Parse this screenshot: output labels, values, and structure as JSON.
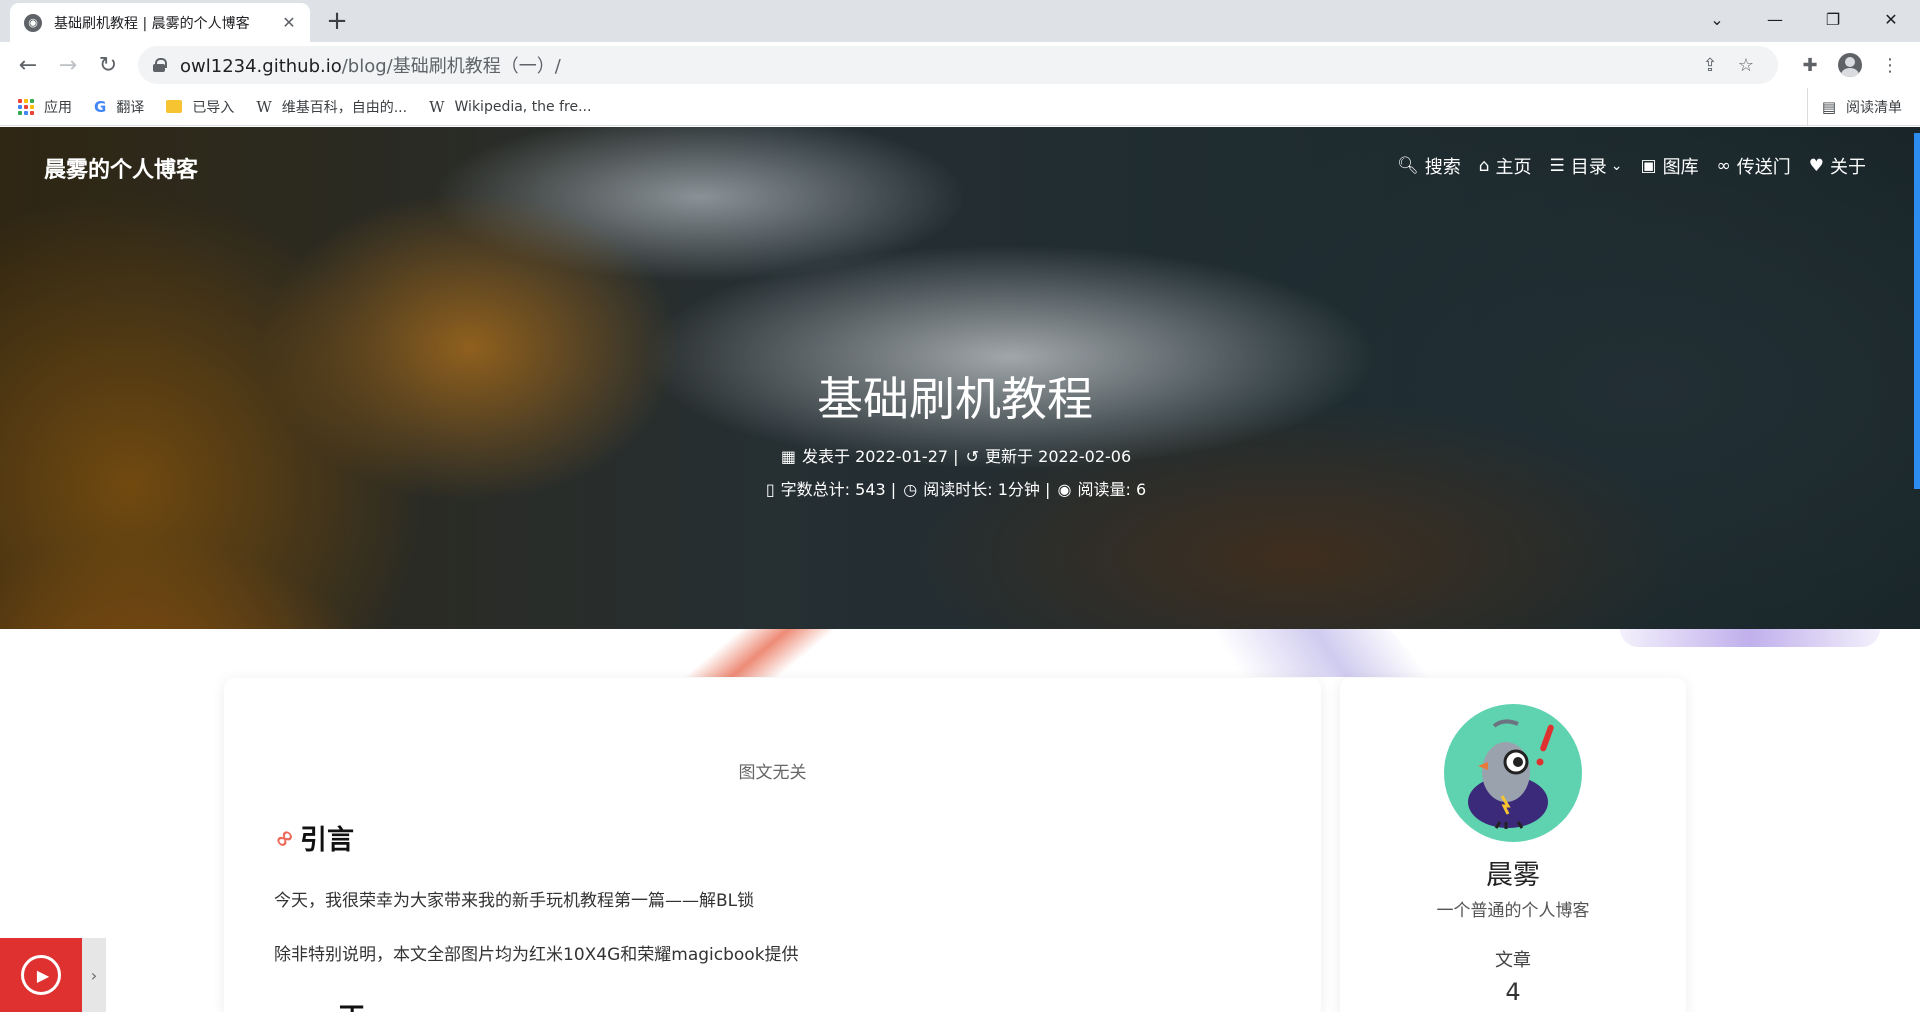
{
  "browser": {
    "tab_title": "基础刷机教程 | 晨雾的个人博客",
    "url_host": "owl1234.github.io",
    "url_path": "/blog/基础刷机教程（一）/",
    "bookmarks": [
      {
        "label": "应用",
        "icon": "apps-grid-icon"
      },
      {
        "label": "翻译",
        "icon": "translate-icon"
      },
      {
        "label": "已导入",
        "icon": "folder-icon"
      },
      {
        "label": "维基百科，自由的...",
        "icon": "wikipedia-icon"
      },
      {
        "label": "Wikipedia, the fre...",
        "icon": "wikipedia-icon"
      }
    ],
    "reading_list": "阅读清单"
  },
  "site": {
    "brand": "晨雾的个人博客",
    "menu": [
      {
        "label": "搜索",
        "icon": "search-icon"
      },
      {
        "label": "主页",
        "icon": "home-icon"
      },
      {
        "label": "目录",
        "icon": "list-icon"
      },
      {
        "label": "图库",
        "icon": "gallery-icon"
      },
      {
        "label": "传送门",
        "icon": "link-icon"
      },
      {
        "label": "关于",
        "icon": "heart-icon"
      }
    ]
  },
  "post": {
    "title": "基础刷机教程",
    "published_label": "发表于",
    "published": "2022-01-27",
    "updated_label": "更新于",
    "updated": "2022-02-06",
    "word_count_label": "字数总计:",
    "word_count": "543",
    "read_time_label": "阅读时长:",
    "read_time": "1分钟",
    "views_label": "阅读量:",
    "views": "6",
    "image_caption": "图文无关",
    "heading_intro": "引言",
    "paragraph_1": "今天，我很荣幸为大家带来我的新手玩机教程第一篇——解BL锁",
    "paragraph_2": "除非特别说明，本文全部图片均为红米10X4G和荣耀magicbook提供",
    "heading_next_partial": "一、正"
  },
  "sidebar": {
    "author": "晨雾",
    "description": "一个普通的个人博客",
    "articles_label": "文章",
    "articles_count": "4"
  },
  "colors": {
    "accent": "#2d8cf0",
    "player": "#e03131",
    "link_icon": "#ee6a58"
  }
}
